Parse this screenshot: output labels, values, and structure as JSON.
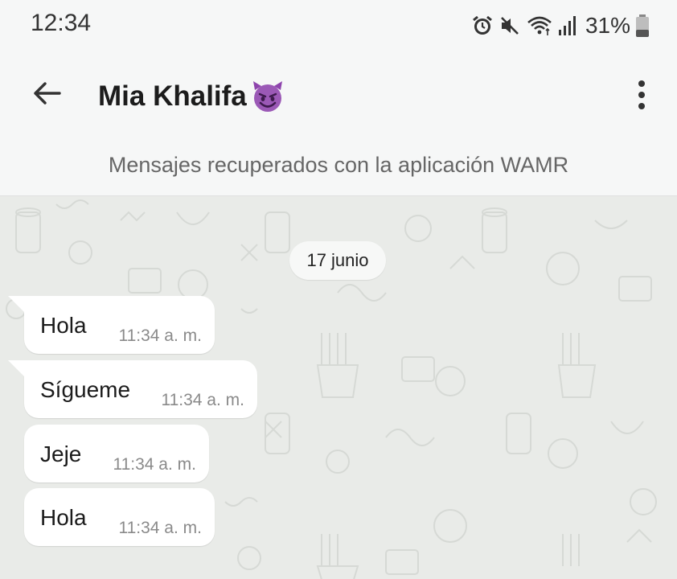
{
  "status_bar": {
    "time": "12:34",
    "battery": "31%",
    "icons": [
      "alarm-icon",
      "mute-icon",
      "wifi-icon",
      "signal-icon",
      "battery-icon"
    ]
  },
  "header": {
    "back_icon": "arrow-left-icon",
    "contact_name": "Mia Khalifa",
    "contact_emoji": "smiling-devil-emoji",
    "menu_icon": "more-vertical-icon",
    "subtitle": "Mensajes recuperados con la aplicación WAMR"
  },
  "chat": {
    "date_label": "17 junio",
    "messages": [
      {
        "text": "Hola",
        "time": "11:34 a. m."
      },
      {
        "text": "Sígueme",
        "time": "11:34 a. m."
      },
      {
        "text": "Jeje",
        "time": "11:34 a. m."
      },
      {
        "text": "Hola",
        "time": "11:34 a. m."
      }
    ]
  },
  "colors": {
    "background": "#f6f7f7",
    "chat_background": "#e9ebe8",
    "bubble": "#ffffff",
    "emoji_purple": "#8e44ad"
  }
}
